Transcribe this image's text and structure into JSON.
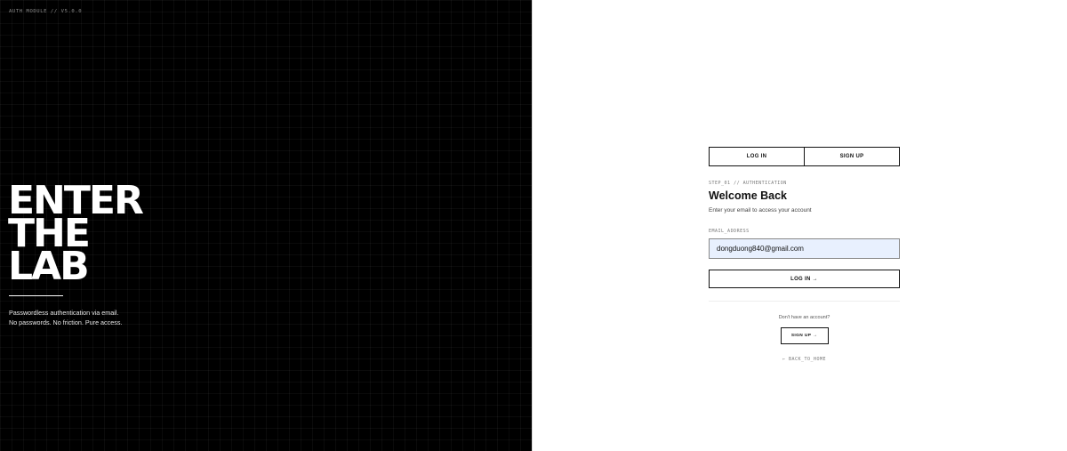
{
  "left": {
    "version": "AUTH MODULE // V5.0.0",
    "hero": [
      "ENTER",
      "THE",
      "LAB"
    ],
    "tagline": [
      "Passwordless authentication via email.",
      "No passwords. No friction. Pure access."
    ]
  },
  "form": {
    "tabs": [
      {
        "label": "LOG IN",
        "active": true
      },
      {
        "label": "SIGN UP",
        "active": false
      }
    ],
    "step": "STEP_01 // AUTHENTICATION",
    "title": "Welcome Back",
    "subtitle": "Enter your email to access your account",
    "email_label": "EMAIL_ADDRESS",
    "email_value": "dongduong840@gmail.com",
    "submit_label": "LOG IN →",
    "no_account": "Don't have an account?",
    "signup_label": "SIGN UP →",
    "back_label": "← BACK_TO_HOME"
  },
  "colors": {
    "left_bg": "#000000",
    "right_bg": "#ffffff",
    "input_bg": "#e8f0fe",
    "ink": "#111111"
  }
}
